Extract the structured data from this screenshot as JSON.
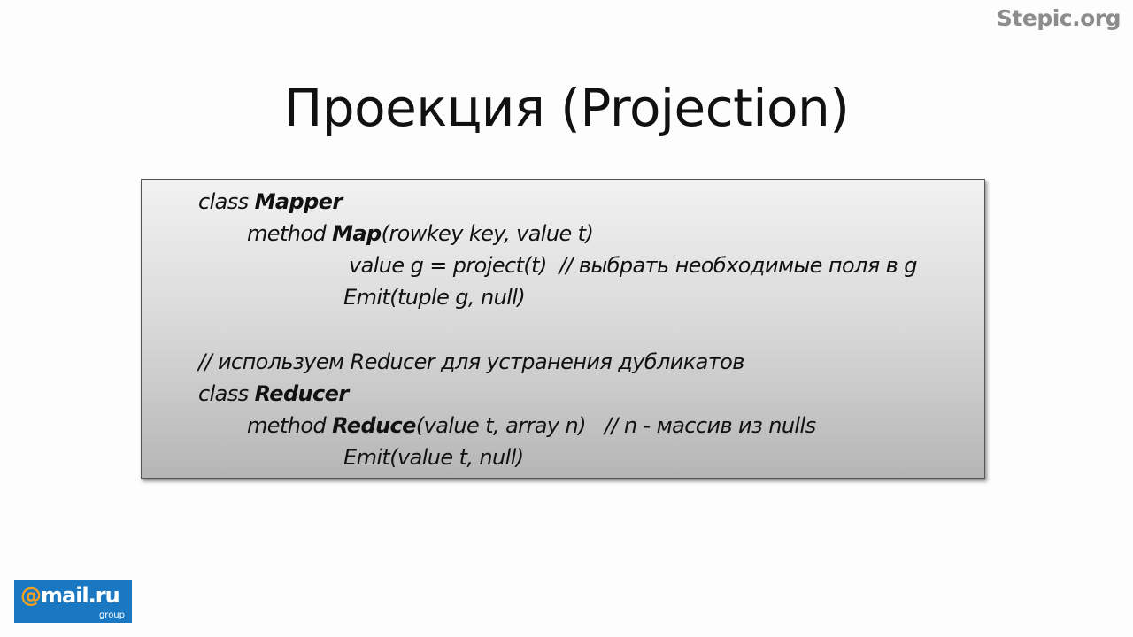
{
  "header": {
    "brand": "Stepic.org"
  },
  "slide": {
    "title": "Проекция (Projection)"
  },
  "code": {
    "l1_a": "class ",
    "l1_b": "Mapper",
    "l2_a": "method ",
    "l2_b": "Map",
    "l2_c": "(rowkey key, value t)",
    "l3": "value g = project(t)  // выбрать необходимые поля в g",
    "l4": "Emit(tuple g, null)",
    "l5": "// используем Reducer для устранения дубликатов",
    "l6_a": "class ",
    "l6_b": "Reducer",
    "l7_a": "method ",
    "l7_b": "Reduce",
    "l7_c": "(value t, array n)   // n - массив из nulls",
    "l8": "Emit(value t, null)"
  },
  "logo": {
    "at": "@",
    "name": "mail.ru",
    "sub": "group"
  },
  "colors": {
    "logo_bg": "#1a78c2",
    "logo_at": "#f6a21e",
    "brand": "#8c8c8c"
  }
}
